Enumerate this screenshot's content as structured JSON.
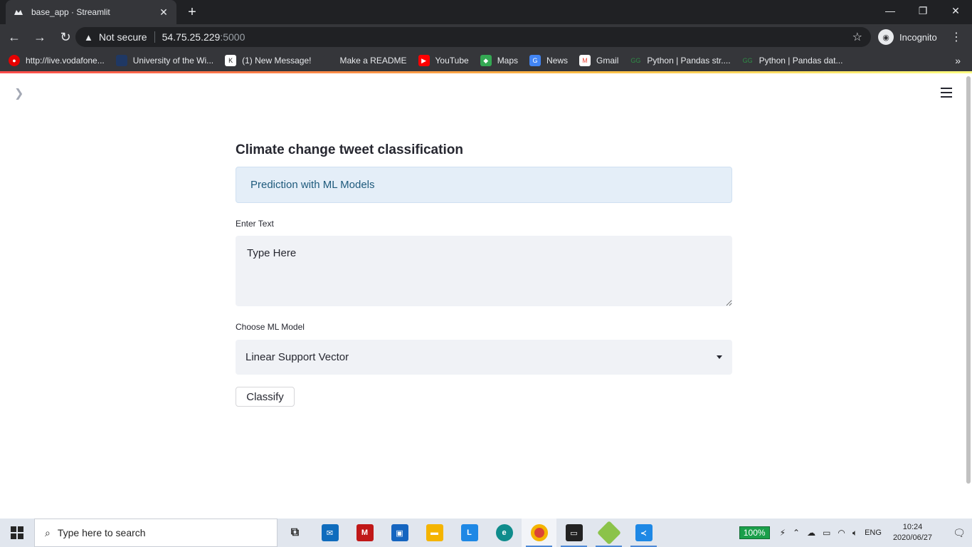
{
  "browser": {
    "tab_title": "base_app · Streamlit",
    "security_label": "Not secure",
    "url_host": "54.75.25.229",
    "url_port": ":5000",
    "profile_label": "Incognito"
  },
  "bookmarks": [
    {
      "label": "http://live.vodafone...",
      "icon": "vodafone-icon",
      "color": "#e60000"
    },
    {
      "label": "University of the Wi...",
      "icon": "university-icon",
      "color": "#1f3864"
    },
    {
      "label": "(1) New Message!",
      "icon": "k-icon",
      "color": "#222222"
    },
    {
      "label": "Make a README",
      "icon": "readme-icon",
      "color": "#35363a"
    },
    {
      "label": "YouTube",
      "icon": "youtube-icon",
      "color": "#ff0000"
    },
    {
      "label": "Maps",
      "icon": "maps-icon",
      "color": "#34a853"
    },
    {
      "label": "News",
      "icon": "news-icon",
      "color": "#4285f4"
    },
    {
      "label": "Gmail",
      "icon": "gmail-icon",
      "color": "#ea4335"
    },
    {
      "label": "Python | Pandas str....",
      "icon": "gfg-icon",
      "color": "#2f8d46"
    },
    {
      "label": "Python | Pandas dat...",
      "icon": "gfg-icon",
      "color": "#2f8d46"
    }
  ],
  "app": {
    "title": "Climate change tweet classification",
    "info_text": "Prediction with ML Models",
    "text_label": "Enter Text",
    "text_value": "Type Here",
    "model_label": "Choose ML Model",
    "model_selected": "Linear Support Vector",
    "classify_label": "Classify"
  },
  "taskbar": {
    "search_placeholder": "Type here to search",
    "battery": "100%",
    "language": "ENG",
    "time": "10:24",
    "date": "2020/06/27"
  }
}
